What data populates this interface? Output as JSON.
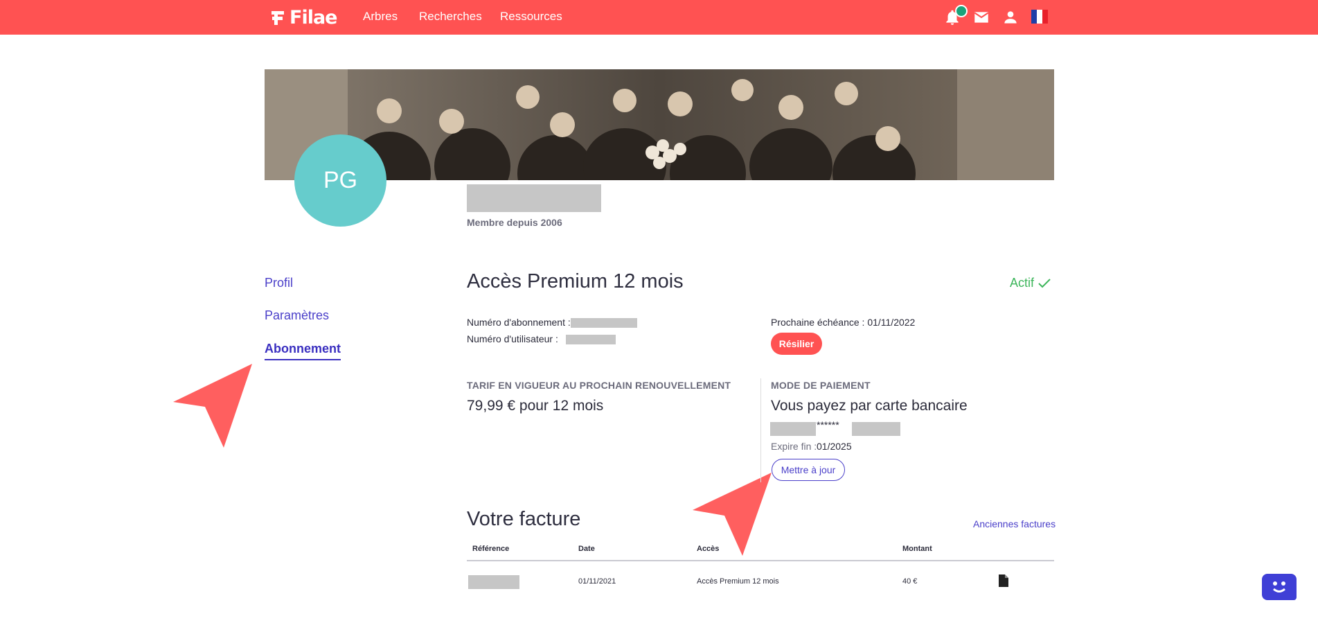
{
  "nav": {
    "logo": "Filae",
    "links": [
      "Arbres",
      "Recherches",
      "Ressources"
    ]
  },
  "profile": {
    "initials": "PG",
    "member_since": "Membre depuis 2006"
  },
  "sidebar": {
    "items": [
      {
        "label": "Profil"
      },
      {
        "label": "Paramètres"
      },
      {
        "label": "Abonnement"
      }
    ]
  },
  "subscription": {
    "title": "Accès Premium 12 mois",
    "status": "Actif",
    "subscription_number_label": "Numéro d'abonnement :",
    "user_number_label": "Numéro d'utilisateur :",
    "next_due": "Prochaine échéance : 01/11/2022",
    "cancel_label": "Résilier",
    "rate_label": "TARIF EN VIGUEUR AU PROCHAIN RENOUVELLEMENT",
    "rate_value": "79,99 € pour 12 mois",
    "payment_label": "MODE DE PAIEMENT",
    "payment_value": "Vous payez par carte bancaire",
    "card_mask": "******",
    "expire_label": "Expire fin :",
    "expire_value": "01/2025",
    "update_label": "Mettre à jour"
  },
  "invoice": {
    "title": "Votre facture",
    "old_invoices": "Anciennes factures",
    "headers": [
      "Référence",
      "Date",
      "Accès",
      "Montant"
    ],
    "rows": [
      {
        "date": "01/11/2021",
        "access": "Accès Premium 12 mois",
        "amount": "40 €"
      }
    ]
  },
  "colors": {
    "brand": "#ff5252",
    "accent": "#4a3fc9",
    "avatar": "#66cccc",
    "active_status": "#3cb55a"
  }
}
